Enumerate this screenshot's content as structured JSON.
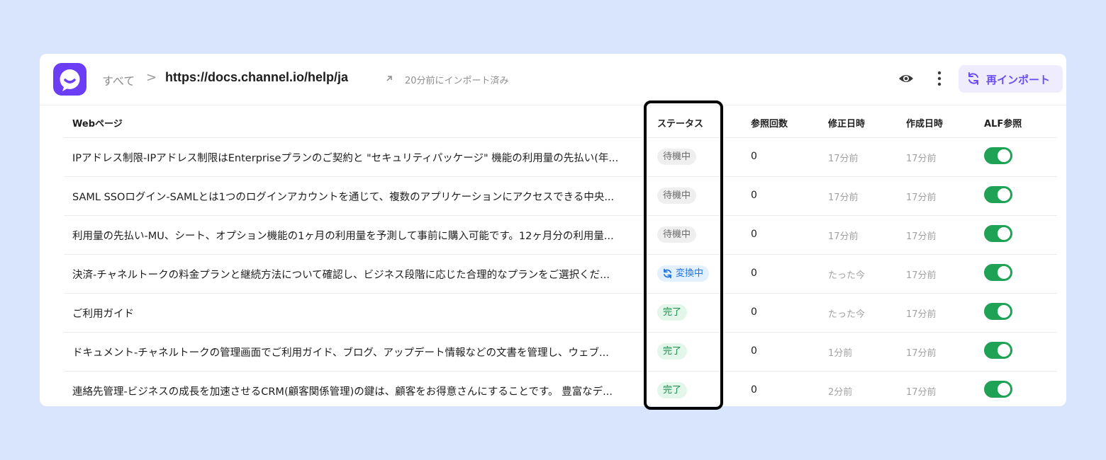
{
  "header": {
    "breadcrumb_root": "すべて",
    "breadcrumb_sep": ">",
    "url": "https://docs.channel.io/help/ja",
    "import_time": "20分前にインポート済み",
    "reimport_label": "再インポート",
    "brand_color": "#6b3df5"
  },
  "table": {
    "columns": {
      "page": "Webページ",
      "status": "ステータス",
      "ref_count": "参照回数",
      "modified": "修正日時",
      "created": "作成日時",
      "alf": "ALF参照"
    },
    "rows": [
      {
        "page": "IPアドレス制限-IPアドレス制限はEnterpriseプランのご契約と \"セキュリティパッケージ\" 機能の利用量の先払い(年...",
        "status": "待機中",
        "status_type": "pending",
        "ref_count": "0",
        "modified": "17分前",
        "created": "17分前",
        "alf_enabled": true
      },
      {
        "page": "SAML SSOログイン-SAMLとは1つのログインアカウントを通じて、複数のアプリケーションにアクセスできる中央...",
        "status": "待機中",
        "status_type": "pending",
        "ref_count": "0",
        "modified": "17分前",
        "created": "17分前",
        "alf_enabled": true
      },
      {
        "page": "利用量の先払い-MU、シート、オプション機能の1ヶ月の利用量を予測して事前に購入可能です。12ヶ月分の利用量...",
        "status": "待機中",
        "status_type": "pending",
        "ref_count": "0",
        "modified": "17分前",
        "created": "17分前",
        "alf_enabled": true
      },
      {
        "page": "決済-チャネルトークの料金プランと継続方法について確認し、ビジネス段階に応じた合理的なプランをご選択くだ...",
        "status": "変換中",
        "status_type": "converting",
        "ref_count": "0",
        "modified": "たった今",
        "created": "17分前",
        "alf_enabled": true
      },
      {
        "page": "ご利用ガイド",
        "status": "完了",
        "status_type": "done",
        "ref_count": "0",
        "modified": "たった今",
        "created": "17分前",
        "alf_enabled": true
      },
      {
        "page": "ドキュメント-チャネルトークの管理画面でご利用ガイド、ブログ、アップデート情報などの文書を管理し、ウェブ...",
        "status": "完了",
        "status_type": "done",
        "ref_count": "0",
        "modified": "1分前",
        "created": "17分前",
        "alf_enabled": true
      },
      {
        "page": "連絡先管理-ビジネスの成長を加速させるCRM(顧客関係管理)の鍵は、顧客をお得意さんにすることです。 豊富なデ...",
        "status": "完了",
        "status_type": "done",
        "ref_count": "0",
        "modified": "2分前",
        "created": "17分前",
        "alf_enabled": true
      }
    ]
  }
}
